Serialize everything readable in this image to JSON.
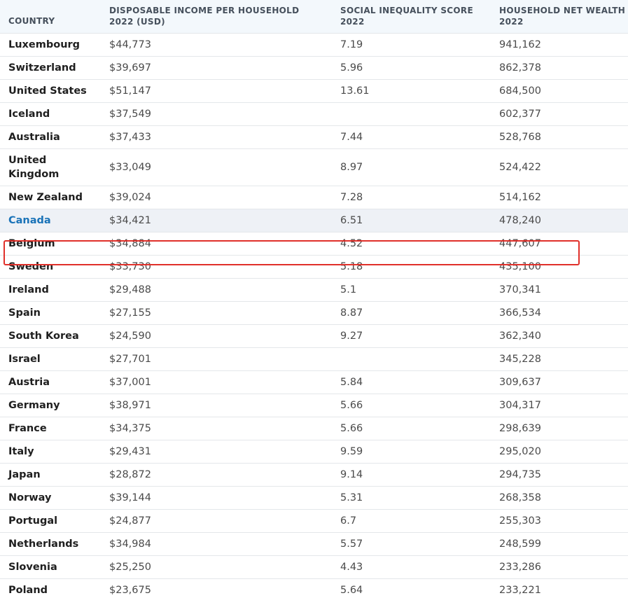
{
  "header": {
    "country": "COUNTRY",
    "income": "DISPOSABLE INCOME PER HOUSEHOLD 2022 (USD)",
    "inequality": "SOCIAL INEQUALITY SCORE 2022",
    "wealth": "HOUSEHOLD NET WEALTH 2022"
  },
  "highlight_color": "#e0302a",
  "link_color": "#1a73b8",
  "rows": [
    {
      "country": "Luxembourg",
      "income": "$44,773",
      "inequality": "7.19",
      "wealth": "941,162"
    },
    {
      "country": "Switzerland",
      "income": "$39,697",
      "inequality": "5.96",
      "wealth": "862,378"
    },
    {
      "country": "United States",
      "income": "$51,147",
      "inequality": "13.61",
      "wealth": "684,500"
    },
    {
      "country": "Iceland",
      "income": "$37,549",
      "inequality": "",
      "wealth": "602,377"
    },
    {
      "country": "Australia",
      "income": "$37,433",
      "inequality": "7.44",
      "wealth": "528,768"
    },
    {
      "country": "United Kingdom",
      "income": "$33,049",
      "inequality": "8.97",
      "wealth": "524,422"
    },
    {
      "country": "New Zealand",
      "income": "$39,024",
      "inequality": "7.28",
      "wealth": "514,162"
    },
    {
      "country": "Canada",
      "income": "$34,421",
      "inequality": "6.51",
      "wealth": "478,240",
      "highlighted": true
    },
    {
      "country": "Belgium",
      "income": "$34,884",
      "inequality": "4.52",
      "wealth": "447,607"
    },
    {
      "country": "Sweden",
      "income": "$33,730",
      "inequality": "5.18",
      "wealth": "435,100"
    },
    {
      "country": "Ireland",
      "income": "$29,488",
      "inequality": "5.1",
      "wealth": "370,341"
    },
    {
      "country": "Spain",
      "income": "$27,155",
      "inequality": "8.87",
      "wealth": "366,534"
    },
    {
      "country": "South Korea",
      "income": "$24,590",
      "inequality": "9.27",
      "wealth": "362,340"
    },
    {
      "country": "Israel",
      "income": "$27,701",
      "inequality": "",
      "wealth": "345,228"
    },
    {
      "country": "Austria",
      "income": "$37,001",
      "inequality": "5.84",
      "wealth": "309,637"
    },
    {
      "country": "Germany",
      "income": "$38,971",
      "inequality": "5.66",
      "wealth": "304,317"
    },
    {
      "country": "France",
      "income": "$34,375",
      "inequality": "5.66",
      "wealth": "298,639"
    },
    {
      "country": "Italy",
      "income": "$29,431",
      "inequality": "9.59",
      "wealth": "295,020"
    },
    {
      "country": "Japan",
      "income": "$28,872",
      "inequality": "9.14",
      "wealth": "294,735"
    },
    {
      "country": "Norway",
      "income": "$39,144",
      "inequality": "5.31",
      "wealth": "268,358"
    },
    {
      "country": "Portugal",
      "income": "$24,877",
      "inequality": "6.7",
      "wealth": "255,303"
    },
    {
      "country": "Netherlands",
      "income": "$34,984",
      "inequality": "5.57",
      "wealth": "248,599"
    },
    {
      "country": "Slovenia",
      "income": "$25,250",
      "inequality": "4.43",
      "wealth": "233,286"
    },
    {
      "country": "Poland",
      "income": "$23,675",
      "inequality": "5.64",
      "wealth": "233,221"
    }
  ]
}
